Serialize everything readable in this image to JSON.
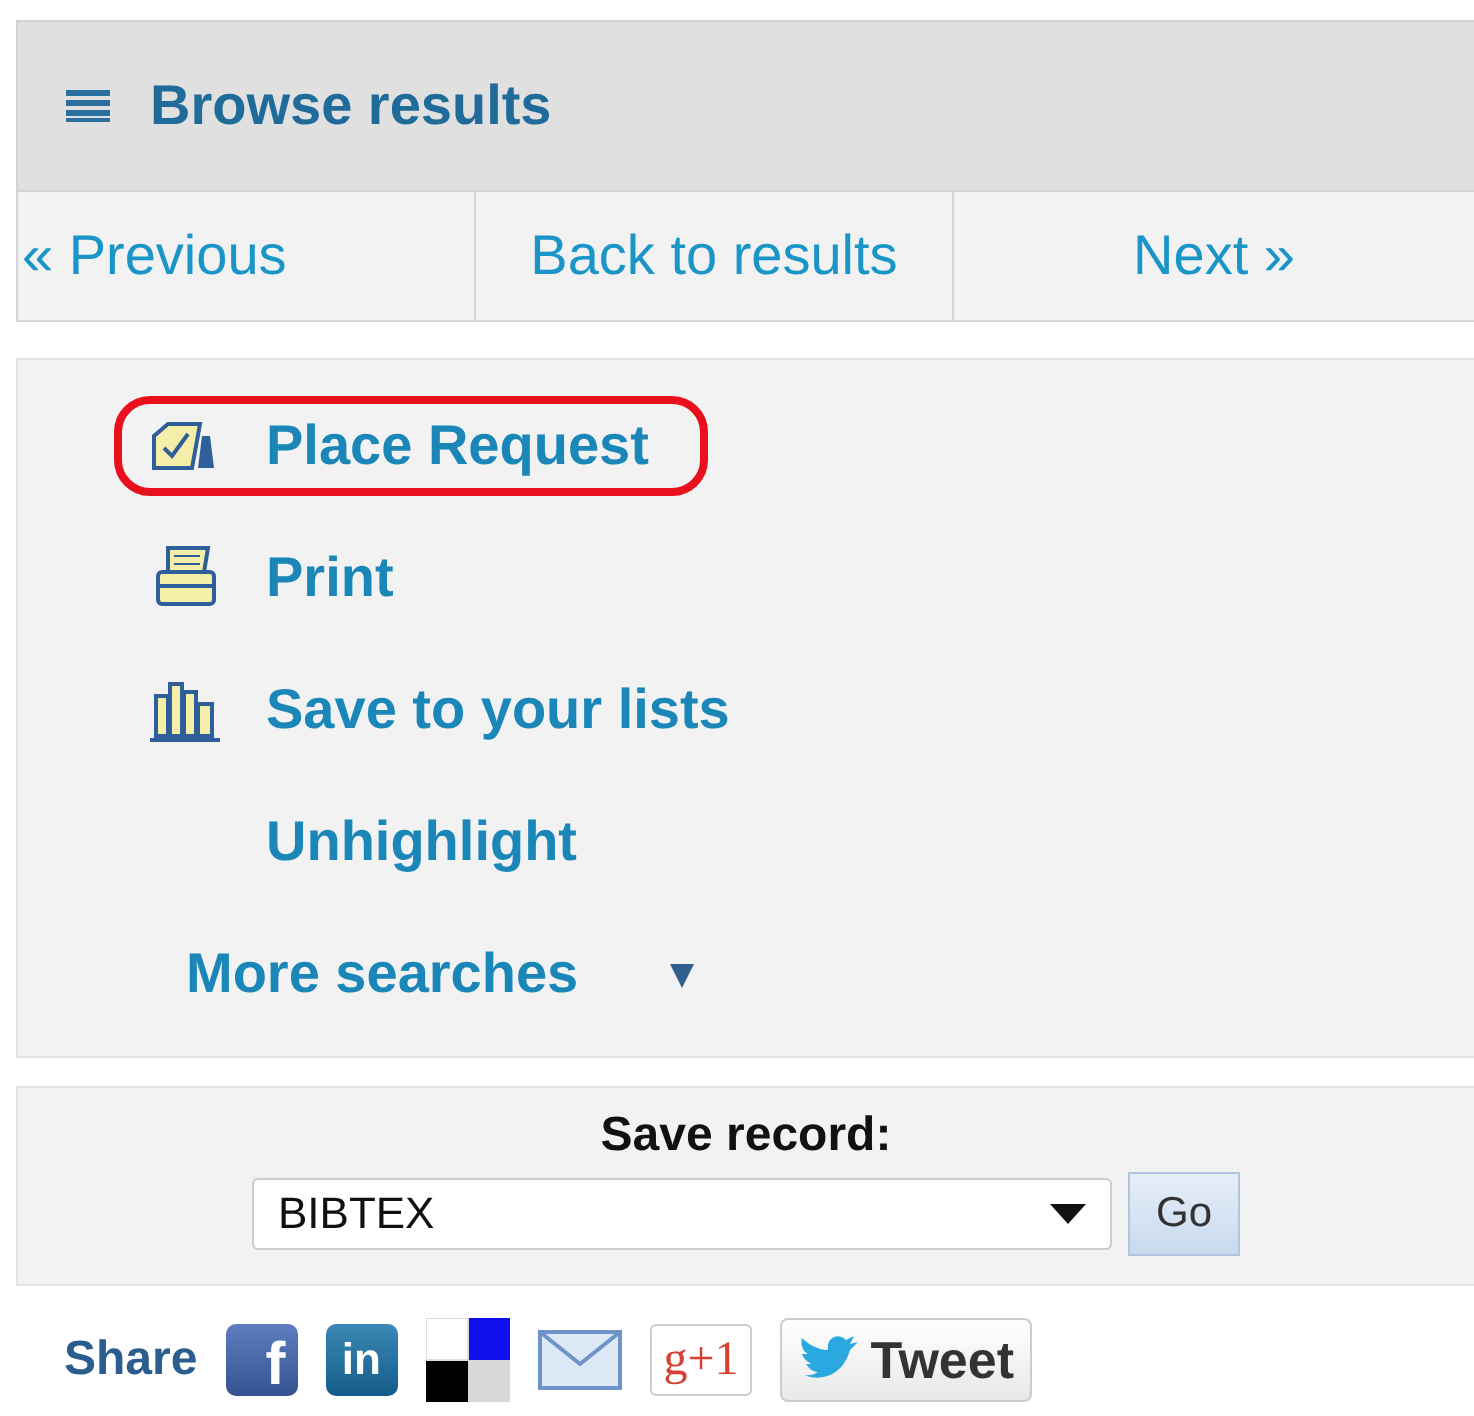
{
  "header": {
    "title": "Browse results"
  },
  "nav": [
    {
      "label": "« Previous"
    },
    {
      "label": "Back to results"
    },
    {
      "label": "Next »"
    }
  ],
  "actions": [
    {
      "kind": "request",
      "label": "Place Request",
      "highlighted": true
    },
    {
      "kind": "print",
      "label": "Print",
      "highlighted": false
    },
    {
      "kind": "lists",
      "label": "Save to your lists",
      "highlighted": false
    },
    {
      "kind": "plain",
      "label": "Unhighlight",
      "highlighted": false
    },
    {
      "kind": "dropdown",
      "label": "More searches",
      "highlighted": false
    }
  ],
  "save_record": {
    "label": "Save record:",
    "format": "BIBTEX",
    "button": "Go"
  },
  "share": {
    "label": "Share",
    "buttons": [
      {
        "kind": "facebook",
        "text": "f"
      },
      {
        "kind": "linkedin",
        "text": "in"
      },
      {
        "kind": "delicious"
      },
      {
        "kind": "email"
      },
      {
        "kind": "googleplus",
        "text": "g+1"
      },
      {
        "kind": "twitter",
        "text": "Tweet"
      }
    ]
  }
}
